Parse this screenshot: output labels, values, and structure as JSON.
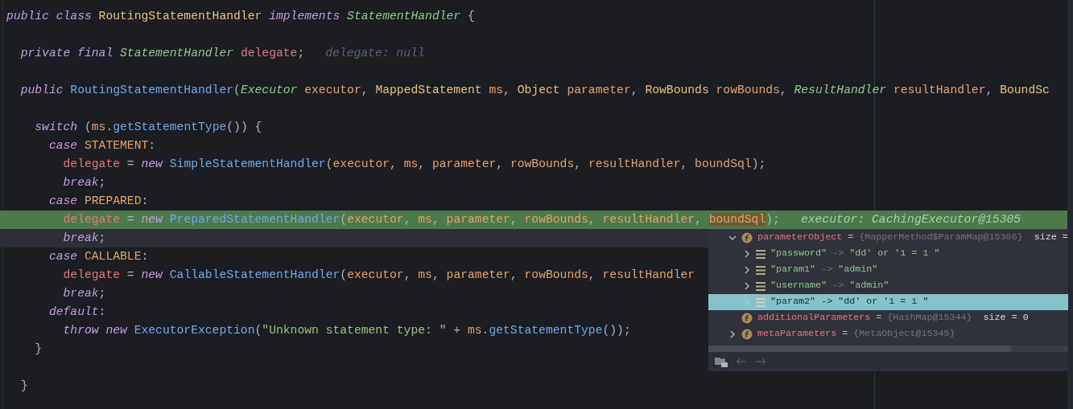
{
  "code": {
    "lines": [
      {
        "execution_point": false,
        "caret_line": false,
        "tokens": [
          {
            "text": "public class ",
            "kind": "keyword"
          },
          {
            "text": "RoutingStatementHandler ",
            "kind": "class"
          },
          {
            "text": "implements ",
            "kind": "keyword"
          },
          {
            "text": "StatementHandler ",
            "kind": "type"
          },
          {
            "text": "{",
            "kind": "punct"
          }
        ]
      },
      {
        "execution_point": false,
        "caret_line": false
      },
      {
        "execution_point": false,
        "caret_line": false,
        "tokens": [
          {
            "text": "  private final ",
            "kind": "keyword"
          },
          {
            "text": "StatementHandler ",
            "kind": "type"
          },
          {
            "text": "delegate",
            "kind": "field"
          },
          {
            "text": ";",
            "kind": "punct"
          }
        ],
        "hint": "delegate: null"
      },
      {
        "execution_point": false,
        "caret_line": false
      },
      {
        "execution_point": false,
        "caret_line": false,
        "tokens": [
          {
            "text": "  public ",
            "kind": "keyword"
          },
          {
            "text": "RoutingStatementHandler",
            "kind": "method"
          },
          {
            "text": "(",
            "kind": "punct"
          },
          {
            "text": "Executor ",
            "kind": "type"
          },
          {
            "text": "executor",
            "kind": "param"
          },
          {
            "text": ", ",
            "kind": "punct"
          },
          {
            "text": "MappedStatement ",
            "kind": "class"
          },
          {
            "text": "ms",
            "kind": "param"
          },
          {
            "text": ", ",
            "kind": "punct"
          },
          {
            "text": "Object ",
            "kind": "class"
          },
          {
            "text": "parameter",
            "kind": "param"
          },
          {
            "text": ", ",
            "kind": "punct"
          },
          {
            "text": "RowBounds ",
            "kind": "class"
          },
          {
            "text": "rowBounds",
            "kind": "param"
          },
          {
            "text": ", ",
            "kind": "punct"
          },
          {
            "text": "ResultHandler ",
            "kind": "type"
          },
          {
            "text": "resultHandler",
            "kind": "param"
          },
          {
            "text": ", ",
            "kind": "punct"
          },
          {
            "text": "BoundSc",
            "kind": "class"
          }
        ]
      },
      {
        "execution_point": false,
        "caret_line": false
      },
      {
        "execution_point": false,
        "caret_line": false,
        "tokens": [
          {
            "text": "    switch ",
            "kind": "keyword"
          },
          {
            "text": "(",
            "kind": "punct"
          },
          {
            "text": "ms",
            "kind": "param"
          },
          {
            "text": ".",
            "kind": "punct"
          },
          {
            "text": "getStatementType",
            "kind": "method"
          },
          {
            "text": "()) {",
            "kind": "punct"
          }
        ]
      },
      {
        "execution_point": false,
        "caret_line": false,
        "tokens": [
          {
            "text": "      case ",
            "kind": "keyword"
          },
          {
            "text": "STATEMENT",
            "kind": "constant"
          },
          {
            "text": ":",
            "kind": "punct"
          }
        ]
      },
      {
        "execution_point": false,
        "caret_line": false,
        "tokens": [
          {
            "text": "        delegate",
            "kind": "field"
          },
          {
            "text": " = ",
            "kind": "punct"
          },
          {
            "text": "new ",
            "kind": "keyword"
          },
          {
            "text": "SimpleStatementHandler",
            "kind": "method"
          },
          {
            "text": "(",
            "kind": "punct"
          },
          {
            "text": "executor",
            "kind": "param"
          },
          {
            "text": ", ",
            "kind": "punct"
          },
          {
            "text": "ms",
            "kind": "param"
          },
          {
            "text": ", ",
            "kind": "punct"
          },
          {
            "text": "parameter",
            "kind": "param"
          },
          {
            "text": ", ",
            "kind": "punct"
          },
          {
            "text": "rowBounds",
            "kind": "param"
          },
          {
            "text": ", ",
            "kind": "punct"
          },
          {
            "text": "resultHandler",
            "kind": "param"
          },
          {
            "text": ", ",
            "kind": "punct"
          },
          {
            "text": "boundSql",
            "kind": "param"
          },
          {
            "text": ");",
            "kind": "punct"
          }
        ]
      },
      {
        "execution_point": false,
        "caret_line": false,
        "tokens": [
          {
            "text": "        break",
            "kind": "keyword"
          },
          {
            "text": ";",
            "kind": "punct"
          }
        ]
      },
      {
        "execution_point": false,
        "caret_line": false,
        "tokens": [
          {
            "text": "      case ",
            "kind": "keyword"
          },
          {
            "text": "PREPARED",
            "kind": "constant"
          },
          {
            "text": ":",
            "kind": "punct"
          }
        ]
      },
      {
        "execution_point": true,
        "caret_line": false,
        "tokens": [
          {
            "text": "        delegate",
            "kind": "field"
          },
          {
            "text": " = ",
            "kind": "punct"
          },
          {
            "text": "new ",
            "kind": "keyword"
          },
          {
            "text": "PreparedStatementHandler",
            "kind": "method"
          },
          {
            "text": "(",
            "kind": "punct"
          },
          {
            "text": "executor",
            "kind": "param"
          },
          {
            "text": ", ",
            "kind": "punct"
          },
          {
            "text": "ms",
            "kind": "param"
          },
          {
            "text": ", ",
            "kind": "punct"
          },
          {
            "text": "parameter",
            "kind": "param"
          },
          {
            "text": ", ",
            "kind": "punct"
          },
          {
            "text": "rowBounds",
            "kind": "param"
          },
          {
            "text": ", ",
            "kind": "punct"
          },
          {
            "text": "resultHandler",
            "kind": "param"
          },
          {
            "text": ", ",
            "kind": "punct"
          },
          {
            "text": "boundSql",
            "kind": "param_marked"
          },
          {
            "text": ");",
            "kind": "punct"
          }
        ],
        "hint": "executor: CachingExecutor@15305"
      },
      {
        "execution_point": false,
        "caret_line": true,
        "tokens": [
          {
            "text": "        break",
            "kind": "keyword"
          },
          {
            "text": ";",
            "kind": "punct"
          }
        ]
      },
      {
        "execution_point": false,
        "caret_line": false,
        "tokens": [
          {
            "text": "      case ",
            "kind": "keyword"
          },
          {
            "text": "CALLABLE",
            "kind": "constant"
          },
          {
            "text": ":",
            "kind": "punct"
          }
        ]
      },
      {
        "execution_point": false,
        "caret_line": false,
        "tokens": [
          {
            "text": "        delegate",
            "kind": "field"
          },
          {
            "text": " = ",
            "kind": "punct"
          },
          {
            "text": "new ",
            "kind": "keyword"
          },
          {
            "text": "CallableStatementHandler",
            "kind": "method"
          },
          {
            "text": "(",
            "kind": "punct"
          },
          {
            "text": "executor",
            "kind": "param"
          },
          {
            "text": ", ",
            "kind": "punct"
          },
          {
            "text": "ms",
            "kind": "param"
          },
          {
            "text": ", ",
            "kind": "punct"
          },
          {
            "text": "parameter",
            "kind": "param"
          },
          {
            "text": ", ",
            "kind": "punct"
          },
          {
            "text": "rowBounds",
            "kind": "param"
          },
          {
            "text": ", ",
            "kind": "punct"
          },
          {
            "text": "resultHandler",
            "kind": "param"
          }
        ]
      },
      {
        "execution_point": false,
        "caret_line": false,
        "tokens": [
          {
            "text": "        break",
            "kind": "keyword"
          },
          {
            "text": ";",
            "kind": "punct"
          }
        ]
      },
      {
        "execution_point": false,
        "caret_line": false,
        "tokens": [
          {
            "text": "      default",
            "kind": "keyword"
          },
          {
            "text": ":",
            "kind": "punct"
          }
        ]
      },
      {
        "execution_point": false,
        "caret_line": false,
        "tokens": [
          {
            "text": "        throw new ",
            "kind": "keyword"
          },
          {
            "text": "ExecutorException",
            "kind": "method"
          },
          {
            "text": "(",
            "kind": "punct"
          },
          {
            "text": "\"Unknown statement type: \"",
            "kind": "string"
          },
          {
            "text": " + ",
            "kind": "punct"
          },
          {
            "text": "ms",
            "kind": "param"
          },
          {
            "text": ".",
            "kind": "punct"
          },
          {
            "text": "getStatementType",
            "kind": "method"
          },
          {
            "text": "());",
            "kind": "punct"
          }
        ]
      },
      {
        "execution_point": false,
        "caret_line": false,
        "tokens": [
          {
            "text": "    }",
            "kind": "punct"
          }
        ]
      },
      {
        "execution_point": false,
        "caret_line": false
      },
      {
        "execution_point": false,
        "caret_line": false,
        "tokens": [
          {
            "text": "  }",
            "kind": "punct"
          }
        ]
      }
    ]
  },
  "variables_popup": {
    "tree": [
      {
        "kind": "field",
        "name": "parameterObject",
        "equals": "=",
        "value": "{MapperMethod$ParamMap@15306}",
        "size": "size =",
        "expandable": true,
        "expanded": true,
        "selected": false,
        "children": [
          {
            "kind": "entry",
            "key": "\"password\"",
            "arrow": "->",
            "value": "\"dd' or '1 = 1 \"",
            "expandable": true,
            "expanded": false,
            "selected": false
          },
          {
            "kind": "entry",
            "key": "\"param1\"",
            "arrow": "->",
            "value": "\"admin\"",
            "expandable": true,
            "expanded": false,
            "selected": false
          },
          {
            "kind": "entry",
            "key": "\"username\"",
            "arrow": "->",
            "value": "\"admin\"",
            "expandable": true,
            "expanded": false,
            "selected": false
          },
          {
            "kind": "entry",
            "key": "\"param2\"",
            "arrow": "->",
            "value": "\"dd' or '1 = 1 \"",
            "expandable": true,
            "expanded": false,
            "selected": true
          }
        ]
      },
      {
        "kind": "field",
        "name": "additionalParameters",
        "equals": "=",
        "value": "{HashMap@15344}",
        "size": "size = 0",
        "expandable": false,
        "expanded": false,
        "selected": false
      },
      {
        "kind": "field",
        "name": "metaParameters",
        "equals": "=",
        "value": "{MetaObject@15345}",
        "expandable": true,
        "expanded": false,
        "selected": false
      }
    ],
    "toolbar": {
      "back_disabled": true,
      "forward_disabled": true
    }
  }
}
